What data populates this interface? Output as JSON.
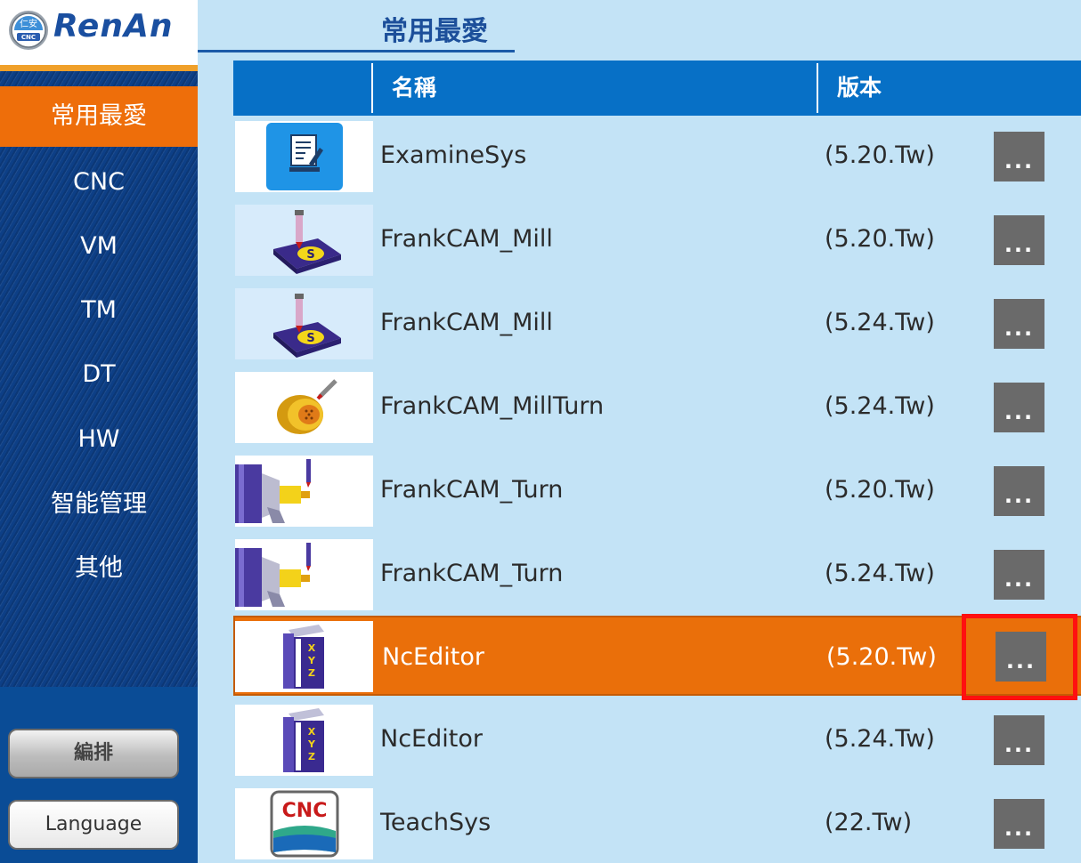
{
  "app": {
    "brand": "RenAn",
    "emblem_text": "仁安",
    "emblem_sub": "CNC"
  },
  "sidebar": {
    "items": [
      {
        "label": "常用最愛",
        "active": true
      },
      {
        "label": "CNC"
      },
      {
        "label": "VM"
      },
      {
        "label": "TM"
      },
      {
        "label": "DT"
      },
      {
        "label": "HW"
      },
      {
        "label": "智能管理"
      },
      {
        "label": "其他"
      }
    ],
    "arrange_button": "編排",
    "language_button": "Language"
  },
  "header": {
    "title": "常用最愛"
  },
  "table": {
    "columns": {
      "name": "名稱",
      "version": "版本"
    },
    "more_label": "...",
    "rows": [
      {
        "name": "ExamineSys",
        "version": "(5.20.Tw)",
        "icon": "examinesys-icon"
      },
      {
        "name": "FrankCAM_Mill",
        "version": "(5.20.Tw)",
        "icon": "frankcam-mill-icon"
      },
      {
        "name": "FrankCAM_Mill",
        "version": "(5.24.Tw)",
        "icon": "frankcam-mill-icon"
      },
      {
        "name": "FrankCAM_MillTurn",
        "version": "(5.24.Tw)",
        "icon": "frankcam-millturn-icon"
      },
      {
        "name": "FrankCAM_Turn",
        "version": "(5.20.Tw)",
        "icon": "frankcam-turn-icon"
      },
      {
        "name": "FrankCAM_Turn",
        "version": "(5.24.Tw)",
        "icon": "frankcam-turn-icon"
      },
      {
        "name": "NcEditor",
        "version": "(5.20.Tw)",
        "icon": "nceditor-book-icon",
        "selected": true
      },
      {
        "name": "NcEditor",
        "version": "(5.24.Tw)",
        "icon": "nceditor-book-icon"
      },
      {
        "name": "TeachSys",
        "version": "(22.Tw)",
        "icon": "teachsys-cnc-icon",
        "icon_text": "CNC"
      }
    ]
  },
  "colors": {
    "accent": "#ee6e0a",
    "header_blue": "#0770c6",
    "content_bg": "#c3e3f6",
    "highlight": "#ff1010"
  }
}
